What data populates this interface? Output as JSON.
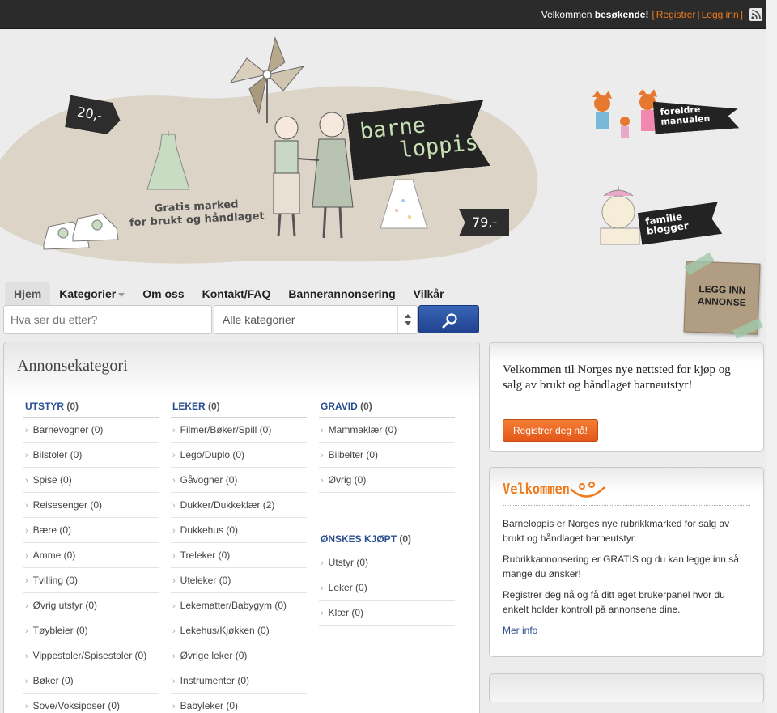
{
  "topbar": {
    "welcome_prefix": "Velkommen ",
    "welcome_user": "besøkende!",
    "open_bracket": "[",
    "register": "Registrer",
    "separator": "|",
    "login": "Logg inn",
    "close_bracket": "]"
  },
  "hero": {
    "price_left": "20,-",
    "price_right": "79,-",
    "logo_line1": "barne",
    "logo_line2": "loppis",
    "tagline_line1": "Gratis marked",
    "tagline_line2": "for brukt og håndlaget",
    "side_flag_1_line1": "foreldre",
    "side_flag_1_line2": "manualen",
    "side_flag_2_line1": "familie",
    "side_flag_2_line2": "blogger",
    "post_ad_line1": "LEGG INN",
    "post_ad_line2": "ANNONSE"
  },
  "nav": {
    "items": [
      {
        "label": "Hjem"
      },
      {
        "label": "Kategorier"
      },
      {
        "label": "Om oss"
      },
      {
        "label": "Kontakt/FAQ"
      },
      {
        "label": "Bannerannonsering"
      },
      {
        "label": "Vilkår"
      }
    ]
  },
  "search": {
    "placeholder": "Hva ser du etter?",
    "category_value": "Alle kategorier"
  },
  "categories": {
    "title": "Annonsekategori",
    "columns": [
      {
        "groups": [
          {
            "name": "UTSTYR",
            "count": "(0)",
            "items": [
              "Barnevogner (0)",
              "Bilstoler (0)",
              "Spise (0)",
              "Reisesenger (0)",
              "Bære (0)",
              "Amme (0)",
              "Tvilling (0)",
              "Øvrig utstyr (0)",
              "Tøybleier (0)",
              "Vippestoler/Spisestoler (0)",
              "Bøker (0)",
              "Sove/Voksiposer (0)"
            ]
          }
        ]
      },
      {
        "groups": [
          {
            "name": "LEKER",
            "count": "(0)",
            "items": [
              "Filmer/Bøker/Spill (0)",
              "Lego/Duplo (0)",
              "Gåvogner (0)",
              "Dukker/Dukkeklær (2)",
              "Dukkehus (0)",
              "Treleker (0)",
              "Uteleker (0)",
              "Lekematter/Babygym (0)",
              "Lekehus/Kjøkken (0)",
              "Øvrige leker (0)",
              "Instrumenter (0)",
              "Babyleker (0)"
            ]
          }
        ]
      },
      {
        "groups": [
          {
            "name": "GRAVID",
            "count": "(0)",
            "items": [
              "Mammaklær (0)",
              "Bilbelter (0)",
              "Øvrig (0)"
            ]
          },
          {
            "name": "ØNSKES KJØPT",
            "count": "(0)",
            "items": [
              "Utstyr (0)",
              "Leker (0)",
              "Klær (0)"
            ]
          }
        ]
      }
    ]
  },
  "welcome_box": {
    "text": "Velkommen til Norges nye nettsted for kjøp og salg av brukt og håndlaget barneutstyr!",
    "button": "Registrer deg nå!"
  },
  "info_box": {
    "title": "Velkommen",
    "p1": "Barneloppis er Norges nye rubrikkmarked for salg av brukt og håndlaget barneutstyr.",
    "p2": "Rubrikkannonsering er GRATIS og du kan legge inn så mange du ønsker!",
    "p3": "Registrer deg nå og få ditt eget brukerpanel hvor du enkelt holder kontroll på annonsene dine.",
    "more": "Mer info"
  },
  "colors": {
    "accent_orange": "#f07b1d",
    "link_blue": "#2a4e8f",
    "topbar_bg": "#2b2b2b",
    "search_button": "#20428f",
    "register_button": "#e4581a"
  },
  "icons": {
    "rss": "rss-icon",
    "search": "magnifier-icon",
    "smile": "smile-face-icon"
  }
}
